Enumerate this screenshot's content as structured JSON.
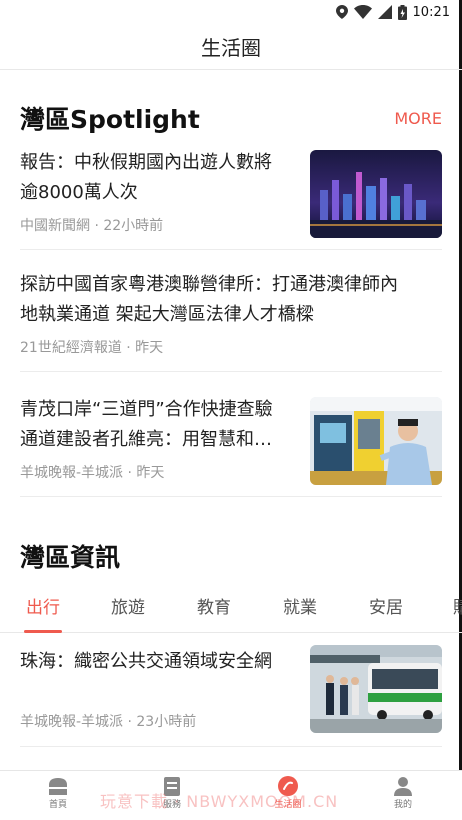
{
  "status": {
    "time": "10:21"
  },
  "header": {
    "title": "生活圈"
  },
  "spotlight": {
    "title": "灣區Spotlight",
    "more": "MORE",
    "items": [
      {
        "title_line1": "報告：中秋假期國內出遊人數將",
        "title_line2": "逾8000萬人次",
        "meta": "中國新聞網 · 22小時前"
      },
      {
        "title_line1": "探訪中國首家粵港澳聯營律所：打通港澳律師內",
        "title_line2": "地執業通道 架起大灣區法律人才橋樑",
        "meta": "21世紀經濟報道 · 昨天"
      },
      {
        "title_line1": "青茂口岸“三道門”合作快捷查驗",
        "title_line2": "通道建設者孔維亮：用智慧和…",
        "meta": "羊城晚報-羊城派 · 昨天"
      }
    ]
  },
  "info": {
    "title": "灣區資訊",
    "tabs": [
      "出行",
      "旅遊",
      "教育",
      "就業",
      "安居",
      "購"
    ],
    "items": [
      {
        "title_line1": "珠海：織密公共交通領域安全網",
        "meta": "羊城晚報-羊城派 · 23小時前"
      }
    ]
  },
  "nav": {
    "items": [
      {
        "label": "首頁",
        "icon": "home-icon"
      },
      {
        "label": "服務",
        "icon": "service-icon"
      },
      {
        "label": "生活圈",
        "icon": "life-circle-icon"
      },
      {
        "label": "我的",
        "icon": "profile-icon"
      }
    ]
  },
  "watermark": "玩意下載 · NBWYXMOOM.CN",
  "colors": {
    "accent": "#ef5a4e",
    "meta": "#999999",
    "text": "#222222"
  }
}
